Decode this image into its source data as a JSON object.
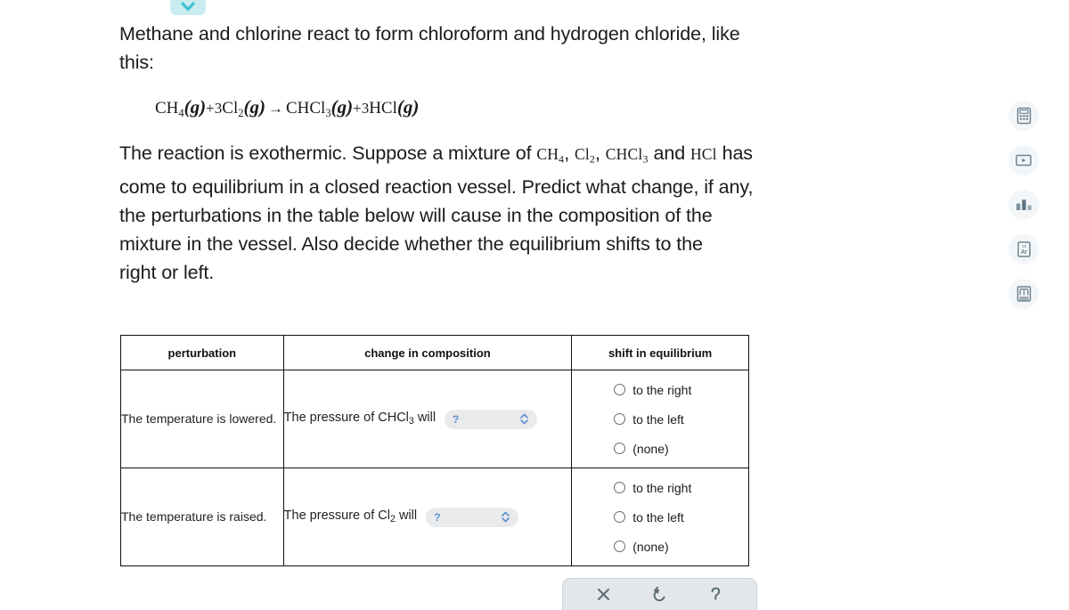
{
  "collapse_badge": {
    "icon": "chevron-down-icon"
  },
  "question": {
    "intro_line1": "Methane and chlorine react to form chloroform and hydrogen chloride, like",
    "intro_line2": "this:",
    "equation": {
      "reactant1": "CH",
      "reactant1_sub": "4",
      "reactant1_state": "(g)",
      "plus1": "+",
      "coef2": "3",
      "reactant2": "Cl",
      "reactant2_sub": "2",
      "reactant2_state": "(g)",
      "arrow": "→",
      "product1": "CHCl",
      "product1_sub": "3",
      "product1_state": "(g)",
      "plus2": "+",
      "coef3": "3",
      "product2": "HCl",
      "product2_state": "(g)"
    },
    "body_a": "The reaction is exothermic. Suppose a mixture of",
    "formula_ch4": "CH",
    "formula_ch4_sub": "4",
    "formula_cl2": "Cl",
    "formula_cl2_sub": "2",
    "formula_chcl3": "CHCl",
    "formula_chcl3_sub": "3",
    "body_b": "and",
    "formula_hcl": "HCl",
    "body_c": "has",
    "body_line2": "come to equilibrium in a closed reaction vessel. Predict what change, if any,",
    "body_line3": "the perturbations in the table below will cause in the composition of the",
    "body_line4": "mixture in the vessel. Also decide whether the equilibrium shifts to the",
    "body_line5": "right or left."
  },
  "table": {
    "headers": {
      "perturbation": "perturbation",
      "composition": "change in composition",
      "shift": "shift in equilibrium"
    },
    "rows": [
      {
        "perturbation": "The temperature is lowered.",
        "composition_prefix": "The pressure of",
        "composition_species": "CHCl",
        "composition_species_sub": "3",
        "composition_suffix": "will",
        "select_value": "?",
        "select_icon": "updown-chevron-icon",
        "options": [
          {
            "label": "to the right",
            "selected": false
          },
          {
            "label": "to the left",
            "selected": false
          },
          {
            "label": "(none)",
            "selected": false
          }
        ]
      },
      {
        "perturbation": "The temperature is raised.",
        "composition_prefix": "The pressure of",
        "composition_species": "Cl",
        "composition_species_sub": "2",
        "composition_suffix": "will",
        "select_value": "?",
        "select_icon": "updown-chevron-icon",
        "options": [
          {
            "label": "to the right",
            "selected": false
          },
          {
            "label": "to the left",
            "selected": false
          },
          {
            "label": "(none)",
            "selected": false
          }
        ]
      }
    ]
  },
  "tool_rail": [
    {
      "name": "calculator-icon",
      "label": "Calculator"
    },
    {
      "name": "video-play-icon",
      "label": "Video"
    },
    {
      "name": "bar-chart-icon",
      "label": "Chart"
    },
    {
      "name": "periodic-table-argon-icon",
      "label": "Ar"
    },
    {
      "name": "reference-book-icon",
      "label": "Reference"
    }
  ],
  "bottom_bar": [
    {
      "name": "close-icon",
      "glyph": "✕"
    },
    {
      "name": "undo-icon",
      "glyph": "↺"
    },
    {
      "name": "help-icon",
      "glyph": "?"
    }
  ],
  "colors": {
    "badge_bg": "#c9ecf1",
    "badge_chevron": "#3fc2d4",
    "select_bg": "#e9eaec",
    "select_accent": "#5d8fce",
    "toolbar_bg": "#e3e7ea",
    "icon_stroke": "#6d8391"
  }
}
